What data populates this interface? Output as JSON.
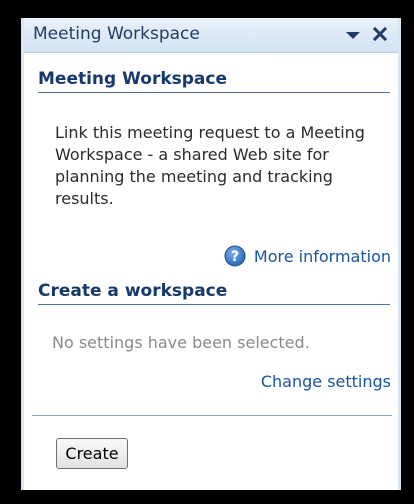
{
  "pane": {
    "title": "Meeting Workspace"
  },
  "section_meeting": {
    "header": "Meeting Workspace",
    "description": "Link this meeting request to a Meeting Workspace - a shared Web site for planning the meeting and tracking results.",
    "more_info_link": "More information"
  },
  "section_create": {
    "header": "Create a workspace",
    "status_text": "No settings have been selected.",
    "change_settings_link": "Change settings",
    "create_button": "Create"
  },
  "icons": {
    "dropdown": "chevron-down-icon",
    "close": "close-icon",
    "help": "help-icon"
  },
  "colors": {
    "title_bar": "#d3e2f3",
    "link": "#1a52a6",
    "header_text": "#15396b",
    "muted_text": "#8a8a8a"
  }
}
